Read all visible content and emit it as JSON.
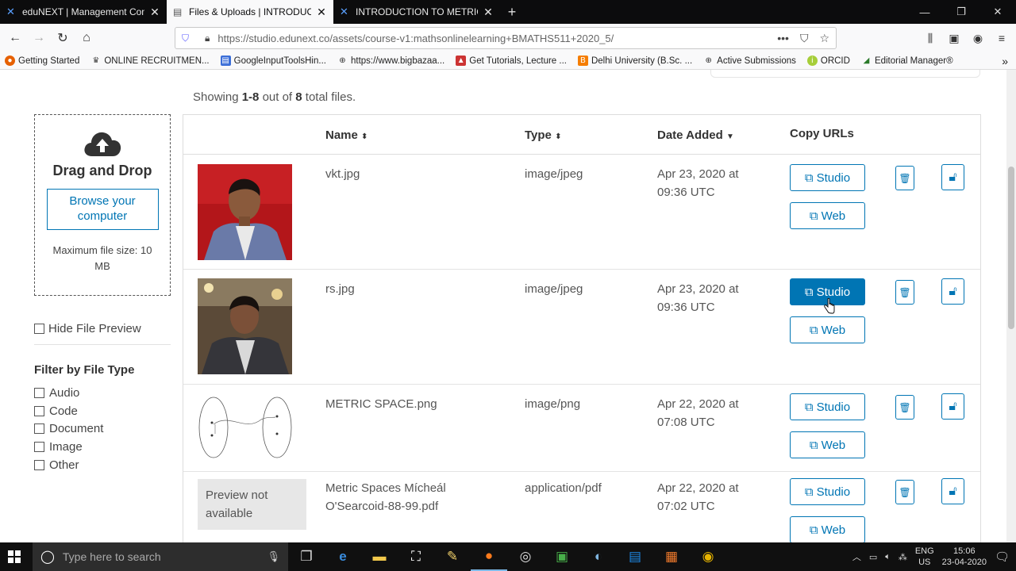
{
  "browser": {
    "tabs": [
      {
        "title": "eduNEXT | Management Cons",
        "active": false,
        "icon": "x-logo-icon"
      },
      {
        "title": "Files & Uploads | INTRODUCTIO",
        "active": true,
        "icon": "page-icon"
      },
      {
        "title": "INTRODUCTION TO METRIC SP",
        "active": false,
        "icon": "x-logo-icon"
      }
    ],
    "url": "https://studio.edunext.co/assets/course-v1:mathsonlinelearning+BMATHS511+2020_5/",
    "bookmarks": [
      "Getting Started",
      "ONLINE RECRUITMEN...",
      "GoogleInputToolsHin...",
      "https://www.bigbazaa...",
      "Get Tutorials, Lecture ...",
      "Delhi University (B.Sc. ...",
      "Active Submissions",
      "ORCID",
      "Editorial Manager®"
    ]
  },
  "page": {
    "showing_prefix": "Showing ",
    "showing_range": "1-8",
    "showing_mid": " out of ",
    "showing_total": "8",
    "showing_suffix": " total files.",
    "upload": {
      "title": "Drag and Drop",
      "browse_label": "Browse your computer",
      "max_size": "Maximum file size: 10 MB"
    },
    "hide_preview_label": "Hide File Preview",
    "filter": {
      "title": "Filter by File Type",
      "options": [
        "Audio",
        "Code",
        "Document",
        "Image",
        "Other"
      ]
    },
    "table": {
      "headers": {
        "name": "Name",
        "type": "Type",
        "date": "Date Added",
        "copy": "Copy URLs"
      },
      "studio_label": "Studio",
      "web_label": "Web",
      "rows": [
        {
          "name": "vkt.jpg",
          "type": "image/jpeg",
          "date_line1": "Apr 23, 2020 at",
          "date_line2": "09:36 UTC",
          "preview": "photo-person-red-background"
        },
        {
          "name": "rs.jpg",
          "type": "image/jpeg",
          "date_line1": "Apr 23, 2020 at",
          "date_line2": "09:36 UTC",
          "preview": "photo-person-indoor"
        },
        {
          "name": "METRIC SPACE.png",
          "type": "image/png",
          "date_line1": "Apr 22, 2020 at",
          "date_line2": "07:08 UTC",
          "preview": "diagram-metric-space"
        },
        {
          "name": "Metric Spaces Mícheál O'Searcoid-88-99.pdf",
          "type": "application/pdf",
          "date_line1": "Apr 22, 2020 at",
          "date_line2": "07:02 UTC",
          "preview_text": "Preview not available"
        }
      ]
    }
  },
  "taskbar": {
    "search_placeholder": "Type here to search",
    "lang1": "ENG",
    "lang2": "US",
    "time": "15:06",
    "date": "23-04-2020"
  },
  "colors": {
    "accent": "#0075b4",
    "tabbar": "#0c0c0d"
  }
}
